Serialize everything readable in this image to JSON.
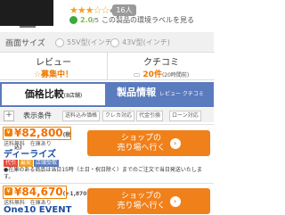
{
  "product": {
    "image_icon": "tv-icon",
    "rating_stars": "★★★☆☆",
    "review_count": "16人",
    "eco_label": "2.0",
    "eco_unit": "/5",
    "eco_text": "この製品の環境ラベルを見る"
  },
  "size_selector": {
    "label": "画面サイズ",
    "options": [
      "55V型(インチ)",
      "43V型(インチ)"
    ]
  },
  "review": {
    "title": "レビュー",
    "status": "募集中！"
  },
  "kuchikomi": {
    "title": "クチコミ",
    "count": "20件",
    "period": "(20時間前)"
  },
  "tabs": {
    "price": {
      "label": "価格比較",
      "sub": "(8店舗)"
    },
    "info": {
      "label": "製品情報",
      "sub": "レビュー クチコミ"
    }
  },
  "conditions": {
    "label": "表示条件",
    "chips": [
      "送料込み価格",
      "クレカ対応",
      "代金引換",
      "ローン対応"
    ]
  },
  "listings": [
    {
      "price": "¥82,800",
      "price_note": "(税込)",
      "shipping": "送料無料",
      "stock": "在庫あり",
      "store": "ディーライズ",
      "tags": [
        "代引",
        "最安",
        "店頭受取"
      ],
      "notice": "●在庫のある商品は当日15時（土日・祝日除く）までのご注文で当日発送いたします。",
      "button": "ショップの\n売り場へ行く"
    },
    {
      "price": "¥84,670",
      "price_note": "(+1,870)",
      "shipping": "送料無料",
      "stock": "在庫あり",
      "store": "One10 EVENT",
      "button": "ショップの\n売り場へ行く"
    }
  ],
  "colors": {
    "accent": "#f0801a",
    "tab_blue": "#5a7bbd"
  }
}
